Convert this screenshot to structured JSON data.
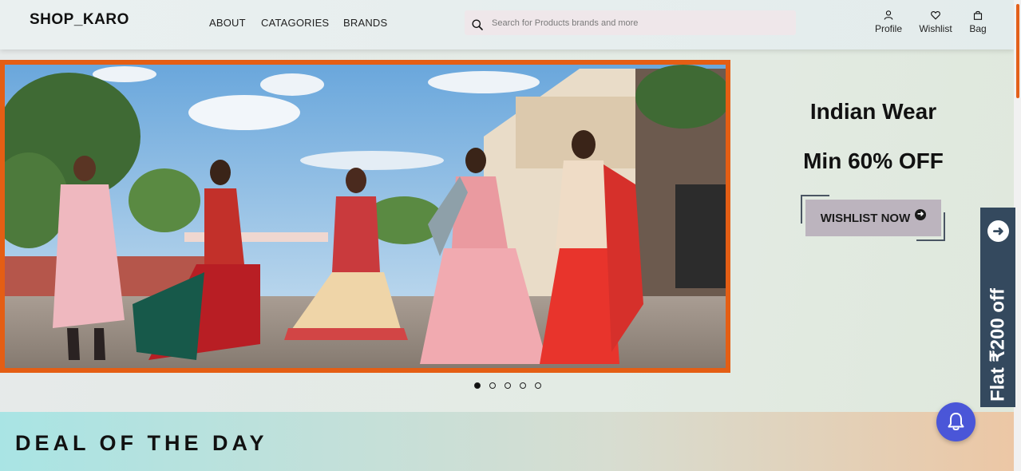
{
  "header": {
    "logo": "SHOP_KARO",
    "nav": [
      {
        "label": "ABOUT"
      },
      {
        "label": "CATAGORIES"
      },
      {
        "label": "BRANDS"
      }
    ],
    "search_placeholder": "Search for Products brands and more",
    "actions": {
      "profile": "Profile",
      "wishlist": "Wishlist",
      "bag": "Bag"
    }
  },
  "hero": {
    "image_icon": "photo-icon",
    "promo_title": "Indian Wear",
    "promo_subtitle": "Min 60% OFF",
    "cta_label": "WISHLIST NOW",
    "slides_total": 5,
    "active_slide": 1
  },
  "offer_tab": {
    "text": "Flat ₹200 off",
    "icon": "arrow-right-icon"
  },
  "deal_section": {
    "title": "DEAL OF THE DAY"
  },
  "notification": {
    "icon": "bell-icon"
  },
  "colors": {
    "accent_orange": "#e45e14",
    "offer_tab": "#34495e",
    "bell_button": "#4a56d8",
    "wishlist_button": "#bcb4be"
  }
}
